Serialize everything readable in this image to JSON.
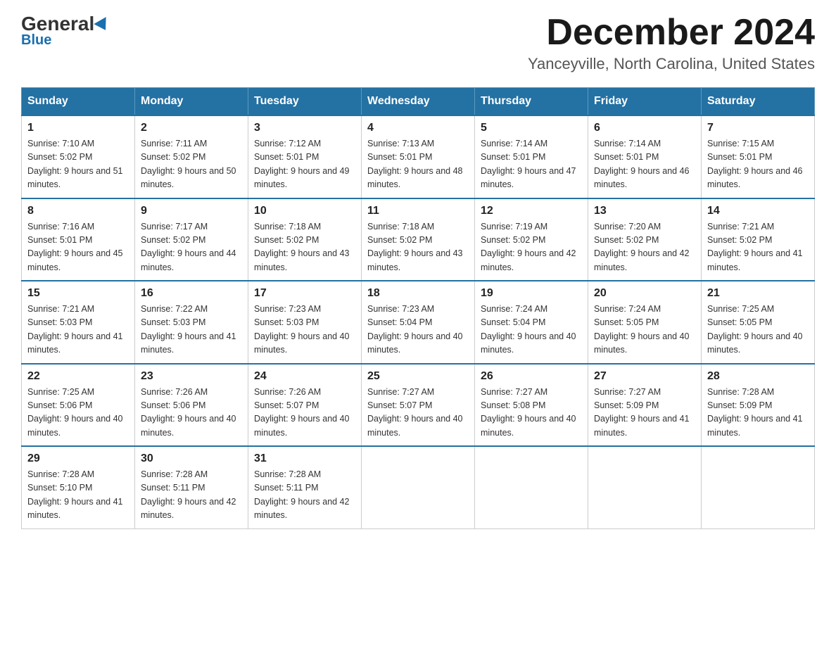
{
  "header": {
    "logo_general": "General",
    "logo_blue": "Blue",
    "month_title": "December 2024",
    "location": "Yanceyville, North Carolina, United States"
  },
  "weekdays": [
    "Sunday",
    "Monday",
    "Tuesday",
    "Wednesday",
    "Thursday",
    "Friday",
    "Saturday"
  ],
  "weeks": [
    [
      {
        "day": "1",
        "sunrise": "7:10 AM",
        "sunset": "5:02 PM",
        "daylight": "9 hours and 51 minutes."
      },
      {
        "day": "2",
        "sunrise": "7:11 AM",
        "sunset": "5:02 PM",
        "daylight": "9 hours and 50 minutes."
      },
      {
        "day": "3",
        "sunrise": "7:12 AM",
        "sunset": "5:01 PM",
        "daylight": "9 hours and 49 minutes."
      },
      {
        "day": "4",
        "sunrise": "7:13 AM",
        "sunset": "5:01 PM",
        "daylight": "9 hours and 48 minutes."
      },
      {
        "day": "5",
        "sunrise": "7:14 AM",
        "sunset": "5:01 PM",
        "daylight": "9 hours and 47 minutes."
      },
      {
        "day": "6",
        "sunrise": "7:14 AM",
        "sunset": "5:01 PM",
        "daylight": "9 hours and 46 minutes."
      },
      {
        "day": "7",
        "sunrise": "7:15 AM",
        "sunset": "5:01 PM",
        "daylight": "9 hours and 46 minutes."
      }
    ],
    [
      {
        "day": "8",
        "sunrise": "7:16 AM",
        "sunset": "5:01 PM",
        "daylight": "9 hours and 45 minutes."
      },
      {
        "day": "9",
        "sunrise": "7:17 AM",
        "sunset": "5:02 PM",
        "daylight": "9 hours and 44 minutes."
      },
      {
        "day": "10",
        "sunrise": "7:18 AM",
        "sunset": "5:02 PM",
        "daylight": "9 hours and 43 minutes."
      },
      {
        "day": "11",
        "sunrise": "7:18 AM",
        "sunset": "5:02 PM",
        "daylight": "9 hours and 43 minutes."
      },
      {
        "day": "12",
        "sunrise": "7:19 AM",
        "sunset": "5:02 PM",
        "daylight": "9 hours and 42 minutes."
      },
      {
        "day": "13",
        "sunrise": "7:20 AM",
        "sunset": "5:02 PM",
        "daylight": "9 hours and 42 minutes."
      },
      {
        "day": "14",
        "sunrise": "7:21 AM",
        "sunset": "5:02 PM",
        "daylight": "9 hours and 41 minutes."
      }
    ],
    [
      {
        "day": "15",
        "sunrise": "7:21 AM",
        "sunset": "5:03 PM",
        "daylight": "9 hours and 41 minutes."
      },
      {
        "day": "16",
        "sunrise": "7:22 AM",
        "sunset": "5:03 PM",
        "daylight": "9 hours and 41 minutes."
      },
      {
        "day": "17",
        "sunrise": "7:23 AM",
        "sunset": "5:03 PM",
        "daylight": "9 hours and 40 minutes."
      },
      {
        "day": "18",
        "sunrise": "7:23 AM",
        "sunset": "5:04 PM",
        "daylight": "9 hours and 40 minutes."
      },
      {
        "day": "19",
        "sunrise": "7:24 AM",
        "sunset": "5:04 PM",
        "daylight": "9 hours and 40 minutes."
      },
      {
        "day": "20",
        "sunrise": "7:24 AM",
        "sunset": "5:05 PM",
        "daylight": "9 hours and 40 minutes."
      },
      {
        "day": "21",
        "sunrise": "7:25 AM",
        "sunset": "5:05 PM",
        "daylight": "9 hours and 40 minutes."
      }
    ],
    [
      {
        "day": "22",
        "sunrise": "7:25 AM",
        "sunset": "5:06 PM",
        "daylight": "9 hours and 40 minutes."
      },
      {
        "day": "23",
        "sunrise": "7:26 AM",
        "sunset": "5:06 PM",
        "daylight": "9 hours and 40 minutes."
      },
      {
        "day": "24",
        "sunrise": "7:26 AM",
        "sunset": "5:07 PM",
        "daylight": "9 hours and 40 minutes."
      },
      {
        "day": "25",
        "sunrise": "7:27 AM",
        "sunset": "5:07 PM",
        "daylight": "9 hours and 40 minutes."
      },
      {
        "day": "26",
        "sunrise": "7:27 AM",
        "sunset": "5:08 PM",
        "daylight": "9 hours and 40 minutes."
      },
      {
        "day": "27",
        "sunrise": "7:27 AM",
        "sunset": "5:09 PM",
        "daylight": "9 hours and 41 minutes."
      },
      {
        "day": "28",
        "sunrise": "7:28 AM",
        "sunset": "5:09 PM",
        "daylight": "9 hours and 41 minutes."
      }
    ],
    [
      {
        "day": "29",
        "sunrise": "7:28 AM",
        "sunset": "5:10 PM",
        "daylight": "9 hours and 41 minutes."
      },
      {
        "day": "30",
        "sunrise": "7:28 AM",
        "sunset": "5:11 PM",
        "daylight": "9 hours and 42 minutes."
      },
      {
        "day": "31",
        "sunrise": "7:28 AM",
        "sunset": "5:11 PM",
        "daylight": "9 hours and 42 minutes."
      },
      null,
      null,
      null,
      null
    ]
  ]
}
